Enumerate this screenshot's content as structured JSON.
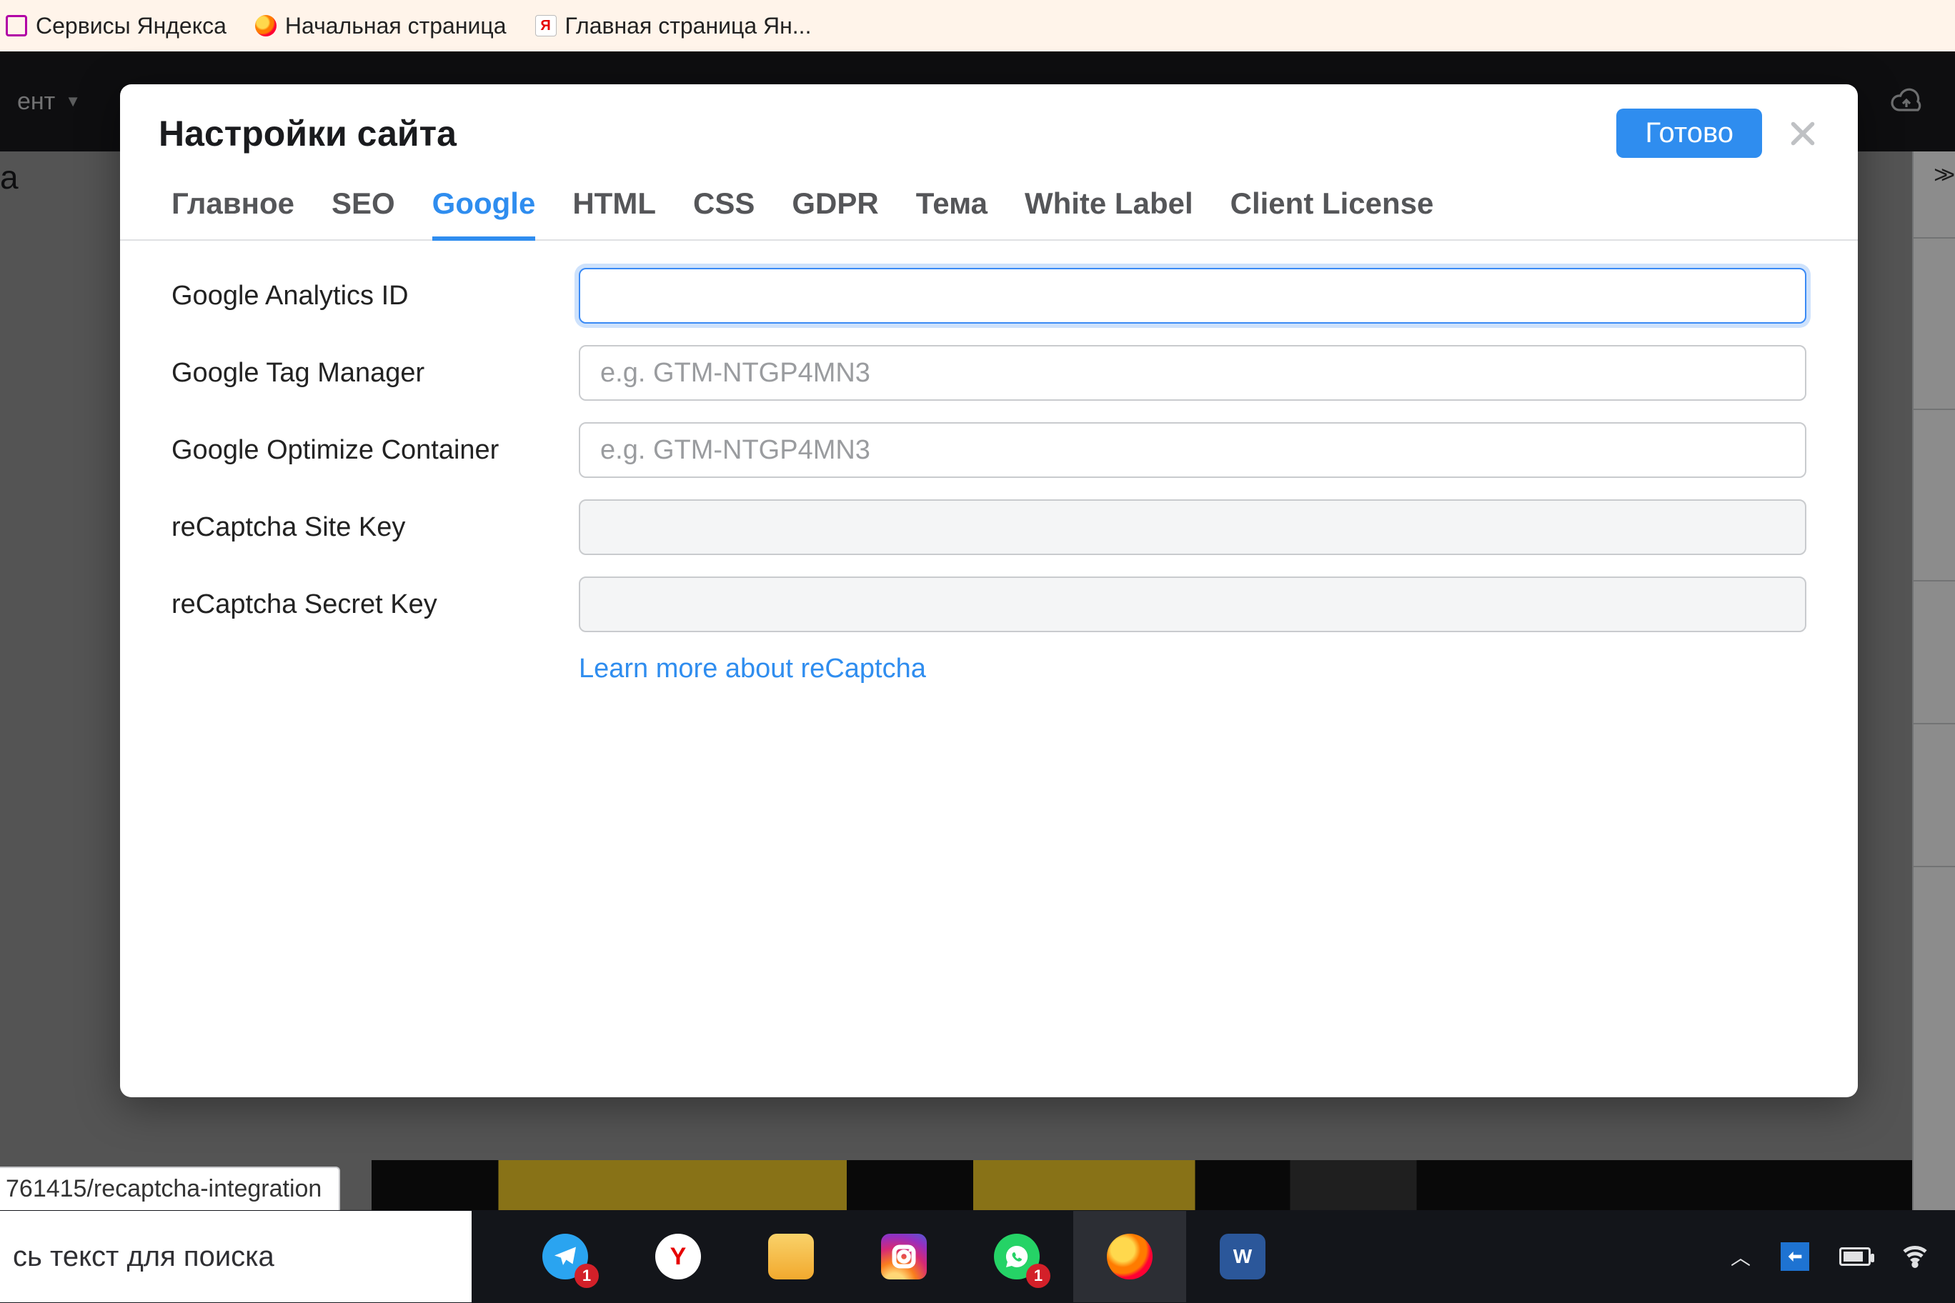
{
  "bookmarks": [
    {
      "label": "Сервисы Яндекса",
      "icon": "pink"
    },
    {
      "label": "Начальная страница",
      "icon": "ff"
    },
    {
      "label": "Главная страница Ян...",
      "icon": "ya",
      "glyph": "Я"
    }
  ],
  "app_toolbar": {
    "left_label_fragment": "ент"
  },
  "bg_letter": "а",
  "right_panel": {
    "chevrons": ">>"
  },
  "modal": {
    "title": "Настройки сайта",
    "done_button": "Готово",
    "tabs": [
      {
        "label": "Главное",
        "active": false
      },
      {
        "label": "SEO",
        "active": false
      },
      {
        "label": "Google",
        "active": true
      },
      {
        "label": "HTML",
        "active": false
      },
      {
        "label": "CSS",
        "active": false
      },
      {
        "label": "GDPR",
        "active": false
      },
      {
        "label": "Тема",
        "active": false
      },
      {
        "label": "White Label",
        "active": false
      },
      {
        "label": "Client License",
        "active": false
      }
    ],
    "fields": {
      "ga_id": {
        "label": "Google Analytics ID",
        "value": "",
        "placeholder": "",
        "focused": true
      },
      "gtm": {
        "label": "Google Tag Manager",
        "value": "",
        "placeholder": "e.g. GTM-NTGP4MN3"
      },
      "optimize": {
        "label": "Google Optimize Container",
        "value": "",
        "placeholder": "e.g. GTM-NTGP4MN3"
      },
      "rc_site": {
        "label": "reCaptcha Site Key",
        "value": "",
        "placeholder": "",
        "readonlyish": true
      },
      "rc_secret": {
        "label": "reCaptcha Secret Key",
        "value": "",
        "placeholder": "",
        "readonlyish": true
      }
    },
    "learn_more": "Learn more about reCaptcha"
  },
  "status_bar": "761415/recaptcha-integration",
  "taskbar": {
    "search_placeholder": "сь текст для поиска",
    "apps": [
      {
        "name": "telegram",
        "badge": "1"
      },
      {
        "name": "yandex",
        "glyph": "Y"
      },
      {
        "name": "explorer"
      },
      {
        "name": "instagram"
      },
      {
        "name": "whatsapp",
        "badge": "1"
      },
      {
        "name": "firefox",
        "active": true
      },
      {
        "name": "word",
        "glyph": "W"
      }
    ]
  }
}
